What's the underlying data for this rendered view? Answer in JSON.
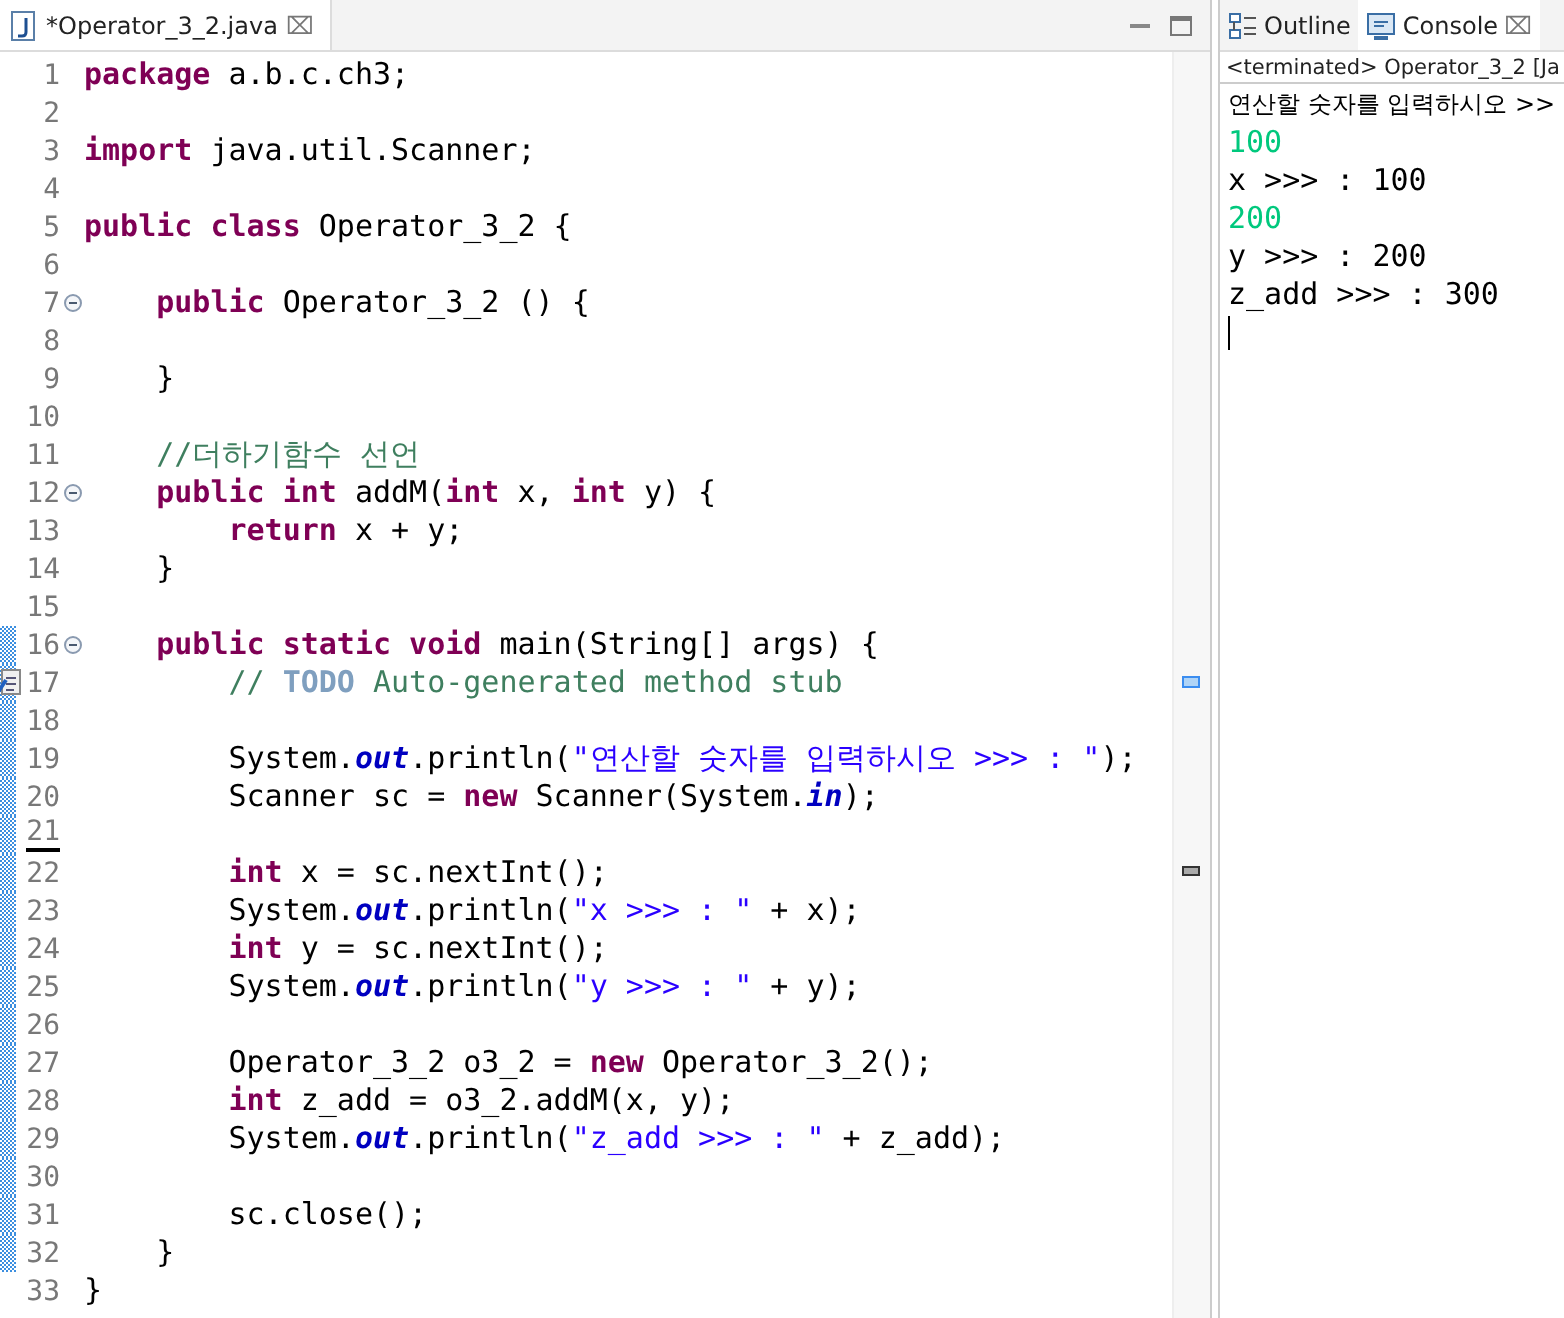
{
  "editor": {
    "tab": {
      "title": "*Operator_3_2.java",
      "close": "⌧",
      "selected": true
    },
    "lines": [
      {
        "number": "1",
        "foldable": false,
        "changed": false,
        "task": false,
        "tokens": [
          {
            "kind": "keyword",
            "text": "package"
          },
          {
            "kind": "plain",
            "text": " a.b.c.ch3;"
          }
        ]
      },
      {
        "number": "2",
        "foldable": false,
        "changed": false,
        "task": false
      },
      {
        "number": "3",
        "foldable": false,
        "changed": false,
        "task": false,
        "tokens": [
          {
            "kind": "keyword",
            "text": "import"
          },
          {
            "kind": "plain",
            "text": " java.util.Scanner;"
          }
        ]
      },
      {
        "number": "4",
        "foldable": false,
        "changed": false,
        "task": false
      },
      {
        "number": "5",
        "foldable": false,
        "changed": false,
        "task": false,
        "tokens": [
          {
            "kind": "keyword",
            "text": "public class"
          },
          {
            "kind": "plain",
            "text": " Operator_3_2 {"
          }
        ]
      },
      {
        "number": "6",
        "foldable": false,
        "changed": false,
        "task": false
      },
      {
        "number": "7",
        "foldable": true,
        "changed": false,
        "task": false,
        "tokens": [
          {
            "kind": "keyword",
            "text": "    public"
          },
          {
            "kind": "plain",
            "text": " Operator_3_2 () {"
          }
        ]
      },
      {
        "number": "8",
        "foldable": false,
        "changed": false,
        "task": false
      },
      {
        "number": "9",
        "foldable": false,
        "changed": false,
        "task": false,
        "tokens": [
          {
            "kind": "plain",
            "text": "    }"
          }
        ]
      },
      {
        "number": "10",
        "foldable": false,
        "changed": false,
        "task": false
      },
      {
        "number": "11",
        "foldable": false,
        "changed": false,
        "task": false,
        "tokens": [
          {
            "kind": "comment",
            "text": "    //더하기함수 선언"
          }
        ]
      },
      {
        "number": "12",
        "foldable": true,
        "changed": false,
        "task": false,
        "tokens": [
          {
            "kind": "keyword",
            "text": "    public int"
          },
          {
            "kind": "plain",
            "text": " addM("
          },
          {
            "kind": "keyword",
            "text": "int"
          },
          {
            "kind": "plain",
            "text": " x, "
          },
          {
            "kind": "keyword",
            "text": "int"
          },
          {
            "kind": "plain",
            "text": " y) {"
          }
        ]
      },
      {
        "number": "13",
        "foldable": false,
        "changed": false,
        "task": false,
        "tokens": [
          {
            "kind": "keyword",
            "text": "        return"
          },
          {
            "kind": "plain",
            "text": " x + y;"
          }
        ]
      },
      {
        "number": "14",
        "foldable": false,
        "changed": false,
        "task": false,
        "tokens": [
          {
            "kind": "plain",
            "text": "    }"
          }
        ]
      },
      {
        "number": "15",
        "foldable": false,
        "changed": false,
        "task": false
      },
      {
        "number": "16",
        "foldable": true,
        "changed": true,
        "task": false,
        "tokens": [
          {
            "kind": "keyword",
            "text": "    public static void"
          },
          {
            "kind": "plain",
            "text": " main(String[] args) {"
          }
        ]
      },
      {
        "number": "17",
        "foldable": false,
        "changed": true,
        "task": true,
        "tokens": [
          {
            "kind": "comment",
            "text": "        // "
          },
          {
            "kind": "task",
            "text": "TODO"
          },
          {
            "kind": "comment",
            "text": " Auto-generated method stub"
          }
        ]
      },
      {
        "number": "18",
        "foldable": false,
        "changed": true,
        "task": false
      },
      {
        "number": "19",
        "foldable": false,
        "changed": true,
        "task": false,
        "tokens": [
          {
            "kind": "plain",
            "text": "        System."
          },
          {
            "kind": "field",
            "text": "out"
          },
          {
            "kind": "plain",
            "text": ".println("
          },
          {
            "kind": "string",
            "text": "\"연산할 숫자를 입력하시오 >>> : \""
          },
          {
            "kind": "plain",
            "text": ");"
          }
        ]
      },
      {
        "number": "20",
        "foldable": false,
        "changed": true,
        "task": false,
        "tokens": [
          {
            "kind": "plain",
            "text": "        Scanner sc = "
          },
          {
            "kind": "keyword",
            "text": "new"
          },
          {
            "kind": "plain",
            "text": " Scanner(System."
          },
          {
            "kind": "field",
            "text": "in"
          },
          {
            "kind": "plain",
            "text": ");"
          }
        ]
      },
      {
        "number": "21",
        "foldable": false,
        "changed": true,
        "task": false
      },
      {
        "number": "22",
        "foldable": false,
        "changed": true,
        "task": false,
        "tokens": [
          {
            "kind": "keyword",
            "text": "        int"
          },
          {
            "kind": "plain",
            "text": " x = sc.nextInt();"
          }
        ]
      },
      {
        "number": "23",
        "foldable": false,
        "changed": true,
        "task": false,
        "tokens": [
          {
            "kind": "plain",
            "text": "        System."
          },
          {
            "kind": "field",
            "text": "out"
          },
          {
            "kind": "plain",
            "text": ".println("
          },
          {
            "kind": "string",
            "text": "\"x >>> : \""
          },
          {
            "kind": "plain",
            "text": " + x);"
          }
        ]
      },
      {
        "number": "24",
        "foldable": false,
        "changed": true,
        "task": false,
        "tokens": [
          {
            "kind": "keyword",
            "text": "        int"
          },
          {
            "kind": "plain",
            "text": " y = sc.nextInt();"
          }
        ]
      },
      {
        "number": "25",
        "foldable": false,
        "changed": true,
        "task": false,
        "tokens": [
          {
            "kind": "plain",
            "text": "        System."
          },
          {
            "kind": "field",
            "text": "out"
          },
          {
            "kind": "plain",
            "text": ".println("
          },
          {
            "kind": "string",
            "text": "\"y >>> : \""
          },
          {
            "kind": "plain",
            "text": " + y);"
          }
        ]
      },
      {
        "number": "26",
        "foldable": false,
        "changed": true,
        "task": false
      },
      {
        "number": "27",
        "foldable": false,
        "changed": true,
        "task": false,
        "tokens": [
          {
            "kind": "plain",
            "text": "        Operator_3_2 o3_2 = "
          },
          {
            "kind": "keyword",
            "text": "new"
          },
          {
            "kind": "plain",
            "text": " Operator_3_2();"
          }
        ]
      },
      {
        "number": "28",
        "foldable": false,
        "changed": true,
        "task": false,
        "tokens": [
          {
            "kind": "keyword",
            "text": "        int"
          },
          {
            "kind": "plain",
            "text": " z_add = o3_2.addM(x, y);"
          }
        ]
      },
      {
        "number": "29",
        "foldable": false,
        "changed": true,
        "task": false,
        "tokens": [
          {
            "kind": "plain",
            "text": "        System."
          },
          {
            "kind": "field",
            "text": "out"
          },
          {
            "kind": "plain",
            "text": ".println("
          },
          {
            "kind": "string",
            "text": "\"z_add >>> : \""
          },
          {
            "kind": "plain",
            "text": " + z_add);"
          }
        ]
      },
      {
        "number": "30",
        "foldable": false,
        "changed": true,
        "task": false
      },
      {
        "number": "31",
        "foldable": false,
        "changed": true,
        "task": false,
        "tokens": [
          {
            "kind": "plain",
            "text": "        sc.close();"
          }
        ]
      },
      {
        "number": "32",
        "foldable": false,
        "changed": true,
        "task": false,
        "tokens": [
          {
            "kind": "plain",
            "text": "    }"
          }
        ]
      },
      {
        "number": "33",
        "foldable": false,
        "changed": false,
        "task": false,
        "tokens": [
          {
            "kind": "plain",
            "text": "}"
          }
        ]
      }
    ]
  },
  "side_panel": {
    "tabs": [
      {
        "label": "Outline",
        "kind": "outline",
        "selected": false
      },
      {
        "label": "Console",
        "kind": "console",
        "selected": true,
        "close": "⌧"
      }
    ],
    "status": "<terminated> Operator_3_2 [Ja",
    "console_lines": [
      {
        "kind": "output",
        "text": "연산할 숫자를 입력하시오 >>"
      },
      {
        "kind": "input",
        "text": "100"
      },
      {
        "kind": "output",
        "text": "x >>> : 100"
      },
      {
        "kind": "input",
        "text": "200"
      },
      {
        "kind": "output",
        "text": "y >>> : 200"
      },
      {
        "kind": "output",
        "text": "z_add >>> : 300"
      }
    ]
  }
}
